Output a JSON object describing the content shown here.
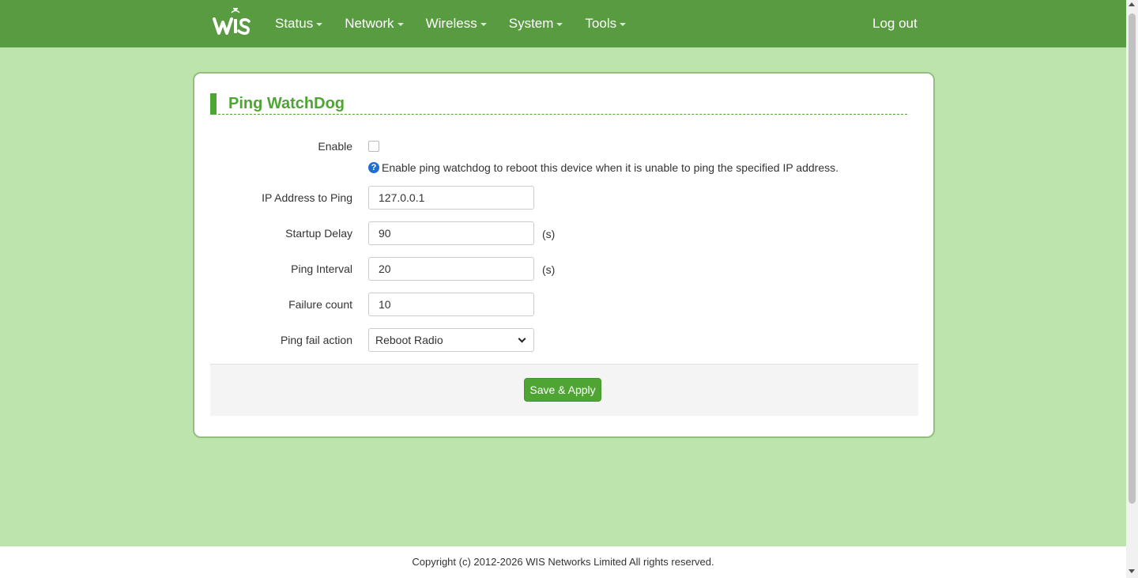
{
  "header": {
    "logo_icon": "wis-logo-icon",
    "nav": [
      {
        "label": "Status"
      },
      {
        "label": "Network"
      },
      {
        "label": "Wireless"
      },
      {
        "label": "System"
      },
      {
        "label": "Tools"
      }
    ],
    "logout_label": "Log out"
  },
  "form": {
    "title": "Ping WatchDog",
    "enable": {
      "label": "Enable",
      "checked": false,
      "help": "Enable ping watchdog to reboot this device when it is unable to ping the specified IP address."
    },
    "ip": {
      "label": "IP Address to Ping",
      "value": "127.0.0.1"
    },
    "startup_delay": {
      "label": "Startup Delay",
      "value": "90",
      "unit": "(s)"
    },
    "ping_interval": {
      "label": "Ping Interval",
      "value": "20",
      "unit": "(s)"
    },
    "failure_count": {
      "label": "Failure count",
      "value": "10"
    },
    "fail_action": {
      "label": "Ping fail action",
      "selected": "Reboot Radio"
    },
    "save_label": "Save & Apply"
  },
  "footer": {
    "copyright": "Copyright (c) 2012-2026 WIS Networks Limited All rights reserved."
  },
  "colors": {
    "header_bg": "#599b41",
    "content_bg": "#bde4ad",
    "accent": "#4ea534",
    "help_icon": "#1e6fd4"
  }
}
